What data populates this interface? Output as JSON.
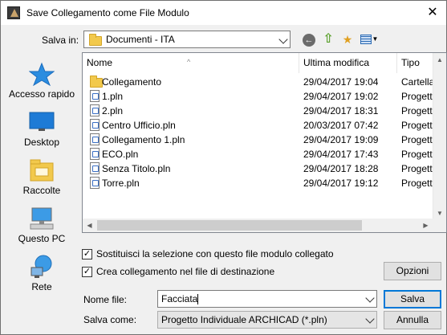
{
  "window": {
    "title": "Save Collegamento come File Modulo",
    "close": "✕"
  },
  "location": {
    "label": "Salva in:",
    "value": "Documenti - ITA"
  },
  "places": [
    {
      "label": "Accesso rapido",
      "icon": "star-icon"
    },
    {
      "label": "Desktop",
      "icon": "desktop-icon"
    },
    {
      "label": "Raccolte",
      "icon": "libraries-icon"
    },
    {
      "label": "Questo PC",
      "icon": "computer-icon"
    },
    {
      "label": "Rete",
      "icon": "network-icon"
    }
  ],
  "file_list": {
    "columns": [
      "Nome",
      "Ultima modifica",
      "Tipo"
    ],
    "rows": [
      {
        "name": "Collegamento",
        "date": "29/04/2017 19:04",
        "type": "Cartella di",
        "kind": "folder"
      },
      {
        "name": "1.pln",
        "date": "29/04/2017 19:02",
        "type": "Progetto I",
        "kind": "pln"
      },
      {
        "name": "2.pln",
        "date": "29/04/2017 18:31",
        "type": "Progetto I",
        "kind": "pln"
      },
      {
        "name": "Centro Ufficio.pln",
        "date": "20/03/2017 07:42",
        "type": "Progetto I",
        "kind": "pln"
      },
      {
        "name": "Collegamento 1.pln",
        "date": "29/04/2017 19:09",
        "type": "Progetto I",
        "kind": "pln"
      },
      {
        "name": "ECO.pln",
        "date": "29/04/2017 17:43",
        "type": "Progetto I",
        "kind": "pln"
      },
      {
        "name": "Senza Titolo.pln",
        "date": "29/04/2017 18:28",
        "type": "Progetto I",
        "kind": "pln"
      },
      {
        "name": "Torre.pln",
        "date": "29/04/2017 19:12",
        "type": "Progetto I",
        "kind": "pln"
      }
    ]
  },
  "options": {
    "replace_selection": {
      "label": "Sostituisci la selezione con questo file modulo collegato",
      "checked": true
    },
    "create_link": {
      "label": "Crea collegamento nel file di destinazione",
      "checked": true
    },
    "options_button": "Opzioni"
  },
  "filename": {
    "label": "Nome file:",
    "value": "Facciata"
  },
  "save_as": {
    "label": "Salva come:",
    "value": "Progetto Individuale ARCHICAD (*.pln)"
  },
  "buttons": {
    "save": "Salva",
    "cancel": "Annulla"
  }
}
